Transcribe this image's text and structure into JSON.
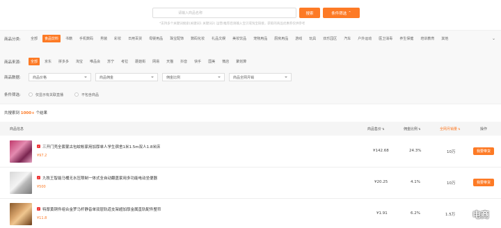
{
  "search": {
    "placeholder": "请输入商品名称",
    "button": "搜索",
    "advanced_button": "条件筛选",
    "hint": "*支持多个关键词搜索(关键词1 关键词2) 运营/推荐后请输入宝贝或淘宝链接，获取的商品优惠券仅供参考"
  },
  "filters": {
    "category_label": "商品分类:",
    "categories": [
      "全部",
      "食品饮料",
      "书籍",
      "手机数码",
      "男装",
      "彩妆",
      "日用百货",
      "母婴用品",
      "珠宝配饰",
      "数码化妆",
      "礼品文娱",
      "美妆饮品",
      "宠物用品",
      "厨房用品",
      "游戏",
      "玩具",
      "双乐园区",
      "汽车",
      "户外运动",
      "医卫消毒",
      "养生保健",
      "培训教育",
      "其他"
    ],
    "category_active": 1,
    "source_label": "商品来源:",
    "sources": [
      "全部",
      "京东",
      "拼多多",
      "淘宝",
      "唯品会",
      "苏宁",
      "考拉",
      "蘑菇街",
      "网易",
      "天猫",
      "抖音",
      "快手",
      "国美",
      "微店",
      "聚划算"
    ],
    "source_active": 0,
    "data_label": "商品数据:",
    "selects": [
      "商品价格",
      "商品佣金",
      "佣金比例",
      "商品全网月销"
    ],
    "condition_label": "条件筛选:",
    "radios": [
      "仅显示有关联直播",
      "不包含商品"
    ]
  },
  "result": {
    "prefix": "共搜索到",
    "count": "1000+",
    "suffix": "个结果"
  },
  "table": {
    "headers": {
      "info": "商品信息",
      "price": "商品售价",
      "ratio": "佣金比例",
      "sales": "全网月销量",
      "action": "操作"
    },
    "rows": [
      {
        "title": "三开门壳全套蒙古包蚊帐家用加厚单人学生宿舍1米1.5m双人1.8米床",
        "price": "¥97.2",
        "sale_price": "¥142.68",
        "ratio": "24.3%",
        "sales": "10万",
        "action": "我要带货"
      },
      {
        "title": "九牧王智能马桶无水压限制一体式全自动翻盖家用多功能电动坐便器",
        "price": "¥500",
        "sale_price": "¥20.25",
        "ratio": "4.1%",
        "sales": "10万",
        "action": "我要带货"
      },
      {
        "title": "特厚黄铜件组合金罗马杆静音单双层轨道支架超加厚金属直轨配件整帘",
        "price": "¥11.8",
        "sale_price": "¥1.91",
        "ratio": "6.2%",
        "sales": "1.5万",
        "action": "我要带货"
      }
    ]
  },
  "watermark": "电商",
  "colors": {
    "accent": "#fd7a25",
    "check": "#ee3333"
  }
}
